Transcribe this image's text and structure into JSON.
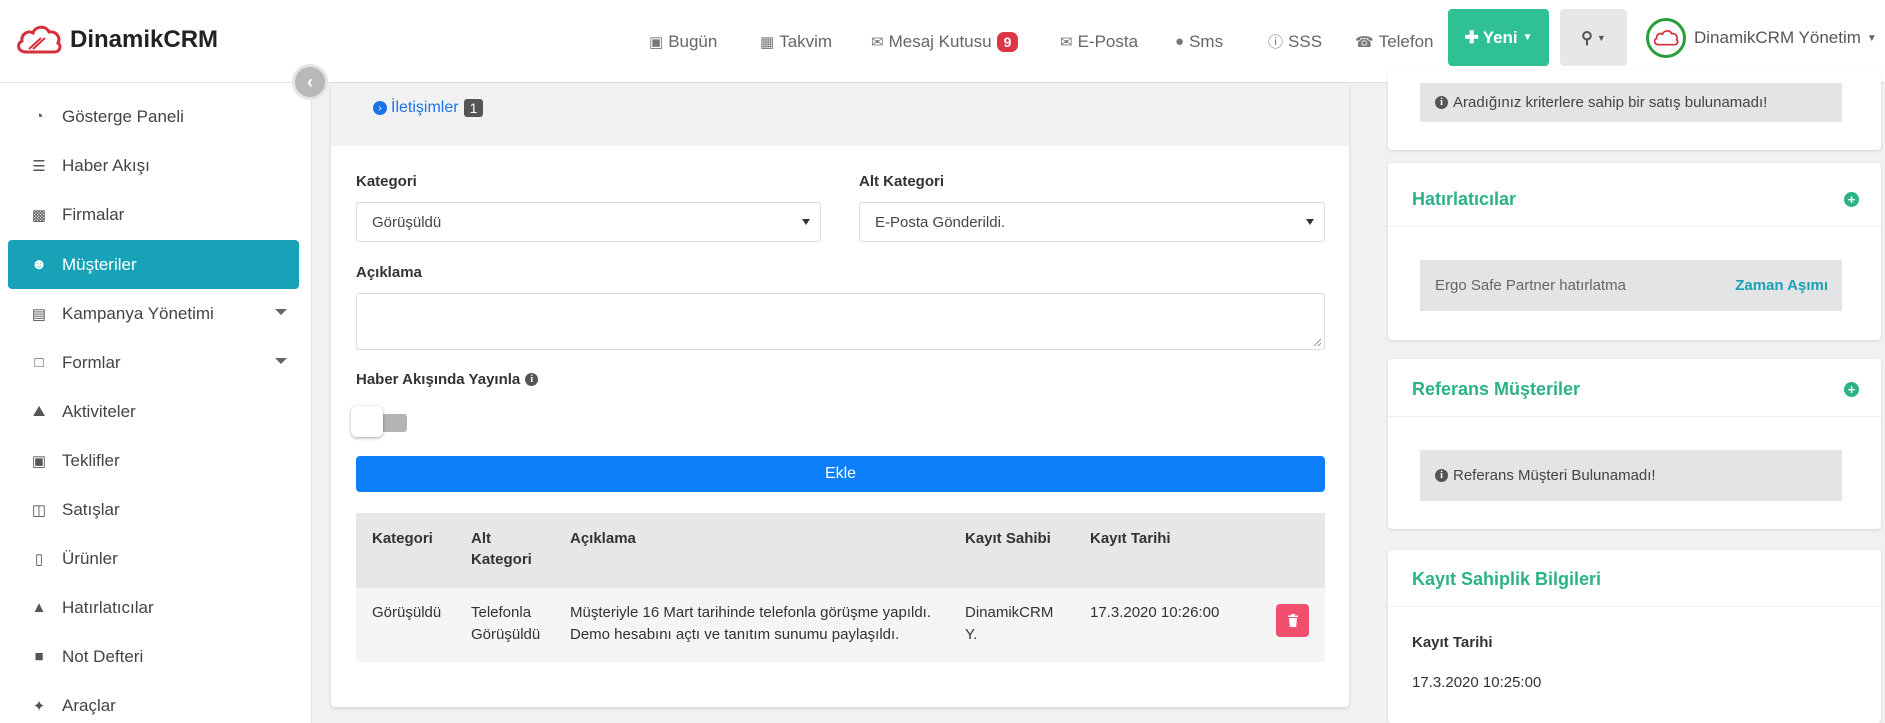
{
  "brand": {
    "name": "DinamikCRM"
  },
  "topnav": {
    "items": [
      {
        "label": "Bugün",
        "icon": "calendar-check-icon"
      },
      {
        "label": "Takvim",
        "icon": "calendar-icon"
      },
      {
        "label": "Mesaj Kutusu",
        "icon": "envelope-outline-icon",
        "badge": "9"
      },
      {
        "label": "E-Posta",
        "icon": "envelope-icon"
      },
      {
        "label": "Sms",
        "icon": "comment-icon"
      },
      {
        "label": "SSS",
        "icon": "info-circle-icon"
      },
      {
        "label": "Telefon",
        "icon": "phone-icon"
      }
    ],
    "new_label": "Yeni",
    "user_name": "DinamikCRM Yönetim"
  },
  "sidebar": {
    "items": [
      {
        "label": "Gösterge Paneli",
        "icon": "dashboard-icon"
      },
      {
        "label": "Haber Akışı",
        "icon": "list-icon"
      },
      {
        "label": "Firmalar",
        "icon": "building-icon"
      },
      {
        "label": "Müşteriler",
        "icon": "users-icon",
        "active": true
      },
      {
        "label": "Kampanya Yönetimi",
        "icon": "gift-icon",
        "has_submenu": true
      },
      {
        "label": "Formlar",
        "icon": "file-icon",
        "has_submenu": true
      },
      {
        "label": "Aktiviteler",
        "icon": "car-icon"
      },
      {
        "label": "Teklifler",
        "icon": "briefcase-icon"
      },
      {
        "label": "Satışlar",
        "icon": "money-icon"
      },
      {
        "label": "Ürünler",
        "icon": "book-icon"
      },
      {
        "label": "Hatırlatıcılar",
        "icon": "bell-icon"
      },
      {
        "label": "Not Defteri",
        "icon": "sticky-note-icon"
      },
      {
        "label": "Araçlar",
        "icon": "wrench-icon"
      }
    ]
  },
  "main": {
    "tab": {
      "label": "İletişimler",
      "count": "1"
    },
    "form": {
      "kategori_label": "Kategori",
      "kategori_value": "Görüşüldü",
      "alt_kategori_label": "Alt Kategori",
      "alt_kategori_value": "E-Posta Gönderildi.",
      "aciklama_label": "Açıklama",
      "aciklama_value": "",
      "haber_label": "Haber Akışında Yayınla",
      "haber_enabled": false,
      "submit_label": "Ekle"
    },
    "table": {
      "headers": [
        "Kategori",
        "Alt Kategori",
        "Açıklama",
        "Kayıt Sahibi",
        "Kayıt Tarihi"
      ],
      "rows": [
        {
          "kategori": "Görüşüldü",
          "alt_kategori": "Telefonla Görüşüldü",
          "aciklama": "Müşteriyle 16 Mart tarihinde telefonla görüşme yapıldı. Demo hesabını açtı ve tanıtım sunumu paylaşıldı.",
          "kayit_sahibi": "DinamikCRM Y.",
          "kayit_tarihi": "17.3.2020 10:26:00"
        }
      ]
    }
  },
  "right": {
    "sales_alert": "Aradığınız kriterlere sahip bir satış bulunamadı!",
    "reminders": {
      "title": "Hatırlatıcılar",
      "item_label": "Ergo Safe Partner hatırlatma",
      "item_status": "Zaman Aşımı"
    },
    "references": {
      "title": "Referans Müşteriler",
      "alert": "Referans Müşteri Bulunamadı!"
    },
    "ownership": {
      "title": "Kayıt Sahiplik Bilgileri",
      "date_label": "Kayıt Tarihi",
      "date_value": "17.3.2020 10:25:00"
    }
  },
  "colors": {
    "accent_teal": "#17a2b8",
    "green": "#2fc094",
    "primary_blue": "#0d7ffa",
    "danger": "#f0506e",
    "badge_red": "#dc3545"
  }
}
